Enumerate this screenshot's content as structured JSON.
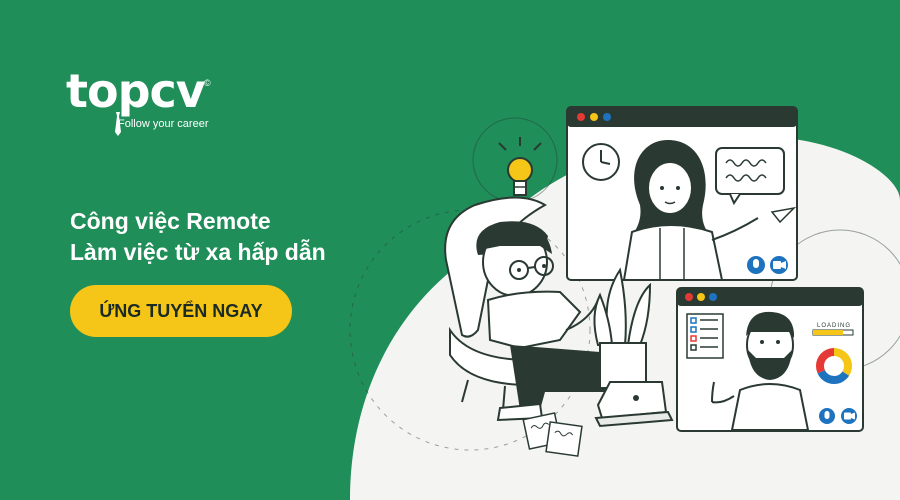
{
  "brand": {
    "name": "topcv",
    "mark": "©",
    "tagline": "Follow your career"
  },
  "headline": {
    "line1": "Công việc Remote",
    "line2": "Làm việc từ xa hấp dẫn"
  },
  "cta": {
    "label": "ỨNG TUYỂN NGAY"
  },
  "illustration": {
    "loading_label": "LOADING"
  },
  "colors": {
    "background": "#1f8e59",
    "accent": "#f5c518",
    "text": "#ffffff",
    "blob": "#f4f5f3"
  }
}
